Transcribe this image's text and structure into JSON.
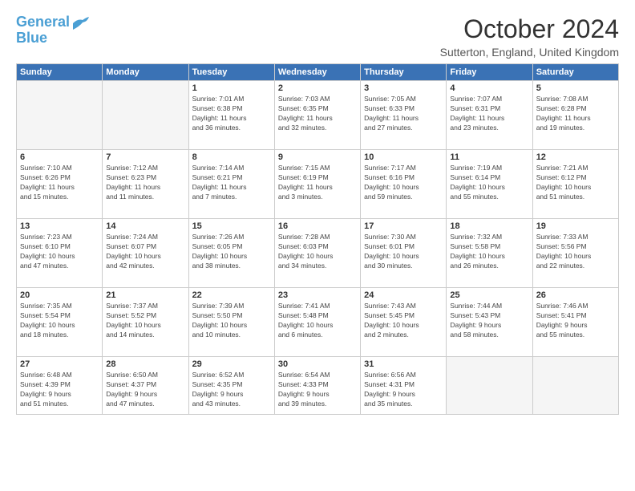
{
  "logo": {
    "line1": "General",
    "line2": "Blue"
  },
  "title": "October 2024",
  "location": "Sutterton, England, United Kingdom",
  "weekdays": [
    "Sunday",
    "Monday",
    "Tuesday",
    "Wednesday",
    "Thursday",
    "Friday",
    "Saturday"
  ],
  "weeks": [
    [
      {
        "day": "",
        "info": ""
      },
      {
        "day": "",
        "info": ""
      },
      {
        "day": "1",
        "info": "Sunrise: 7:01 AM\nSunset: 6:38 PM\nDaylight: 11 hours\nand 36 minutes."
      },
      {
        "day": "2",
        "info": "Sunrise: 7:03 AM\nSunset: 6:35 PM\nDaylight: 11 hours\nand 32 minutes."
      },
      {
        "day": "3",
        "info": "Sunrise: 7:05 AM\nSunset: 6:33 PM\nDaylight: 11 hours\nand 27 minutes."
      },
      {
        "day": "4",
        "info": "Sunrise: 7:07 AM\nSunset: 6:31 PM\nDaylight: 11 hours\nand 23 minutes."
      },
      {
        "day": "5",
        "info": "Sunrise: 7:08 AM\nSunset: 6:28 PM\nDaylight: 11 hours\nand 19 minutes."
      }
    ],
    [
      {
        "day": "6",
        "info": "Sunrise: 7:10 AM\nSunset: 6:26 PM\nDaylight: 11 hours\nand 15 minutes."
      },
      {
        "day": "7",
        "info": "Sunrise: 7:12 AM\nSunset: 6:23 PM\nDaylight: 11 hours\nand 11 minutes."
      },
      {
        "day": "8",
        "info": "Sunrise: 7:14 AM\nSunset: 6:21 PM\nDaylight: 11 hours\nand 7 minutes."
      },
      {
        "day": "9",
        "info": "Sunrise: 7:15 AM\nSunset: 6:19 PM\nDaylight: 11 hours\nand 3 minutes."
      },
      {
        "day": "10",
        "info": "Sunrise: 7:17 AM\nSunset: 6:16 PM\nDaylight: 10 hours\nand 59 minutes."
      },
      {
        "day": "11",
        "info": "Sunrise: 7:19 AM\nSunset: 6:14 PM\nDaylight: 10 hours\nand 55 minutes."
      },
      {
        "day": "12",
        "info": "Sunrise: 7:21 AM\nSunset: 6:12 PM\nDaylight: 10 hours\nand 51 minutes."
      }
    ],
    [
      {
        "day": "13",
        "info": "Sunrise: 7:23 AM\nSunset: 6:10 PM\nDaylight: 10 hours\nand 47 minutes."
      },
      {
        "day": "14",
        "info": "Sunrise: 7:24 AM\nSunset: 6:07 PM\nDaylight: 10 hours\nand 42 minutes."
      },
      {
        "day": "15",
        "info": "Sunrise: 7:26 AM\nSunset: 6:05 PM\nDaylight: 10 hours\nand 38 minutes."
      },
      {
        "day": "16",
        "info": "Sunrise: 7:28 AM\nSunset: 6:03 PM\nDaylight: 10 hours\nand 34 minutes."
      },
      {
        "day": "17",
        "info": "Sunrise: 7:30 AM\nSunset: 6:01 PM\nDaylight: 10 hours\nand 30 minutes."
      },
      {
        "day": "18",
        "info": "Sunrise: 7:32 AM\nSunset: 5:58 PM\nDaylight: 10 hours\nand 26 minutes."
      },
      {
        "day": "19",
        "info": "Sunrise: 7:33 AM\nSunset: 5:56 PM\nDaylight: 10 hours\nand 22 minutes."
      }
    ],
    [
      {
        "day": "20",
        "info": "Sunrise: 7:35 AM\nSunset: 5:54 PM\nDaylight: 10 hours\nand 18 minutes."
      },
      {
        "day": "21",
        "info": "Sunrise: 7:37 AM\nSunset: 5:52 PM\nDaylight: 10 hours\nand 14 minutes."
      },
      {
        "day": "22",
        "info": "Sunrise: 7:39 AM\nSunset: 5:50 PM\nDaylight: 10 hours\nand 10 minutes."
      },
      {
        "day": "23",
        "info": "Sunrise: 7:41 AM\nSunset: 5:48 PM\nDaylight: 10 hours\nand 6 minutes."
      },
      {
        "day": "24",
        "info": "Sunrise: 7:43 AM\nSunset: 5:45 PM\nDaylight: 10 hours\nand 2 minutes."
      },
      {
        "day": "25",
        "info": "Sunrise: 7:44 AM\nSunset: 5:43 PM\nDaylight: 9 hours\nand 58 minutes."
      },
      {
        "day": "26",
        "info": "Sunrise: 7:46 AM\nSunset: 5:41 PM\nDaylight: 9 hours\nand 55 minutes."
      }
    ],
    [
      {
        "day": "27",
        "info": "Sunrise: 6:48 AM\nSunset: 4:39 PM\nDaylight: 9 hours\nand 51 minutes."
      },
      {
        "day": "28",
        "info": "Sunrise: 6:50 AM\nSunset: 4:37 PM\nDaylight: 9 hours\nand 47 minutes."
      },
      {
        "day": "29",
        "info": "Sunrise: 6:52 AM\nSunset: 4:35 PM\nDaylight: 9 hours\nand 43 minutes."
      },
      {
        "day": "30",
        "info": "Sunrise: 6:54 AM\nSunset: 4:33 PM\nDaylight: 9 hours\nand 39 minutes."
      },
      {
        "day": "31",
        "info": "Sunrise: 6:56 AM\nSunset: 4:31 PM\nDaylight: 9 hours\nand 35 minutes."
      },
      {
        "day": "",
        "info": ""
      },
      {
        "day": "",
        "info": ""
      }
    ]
  ]
}
